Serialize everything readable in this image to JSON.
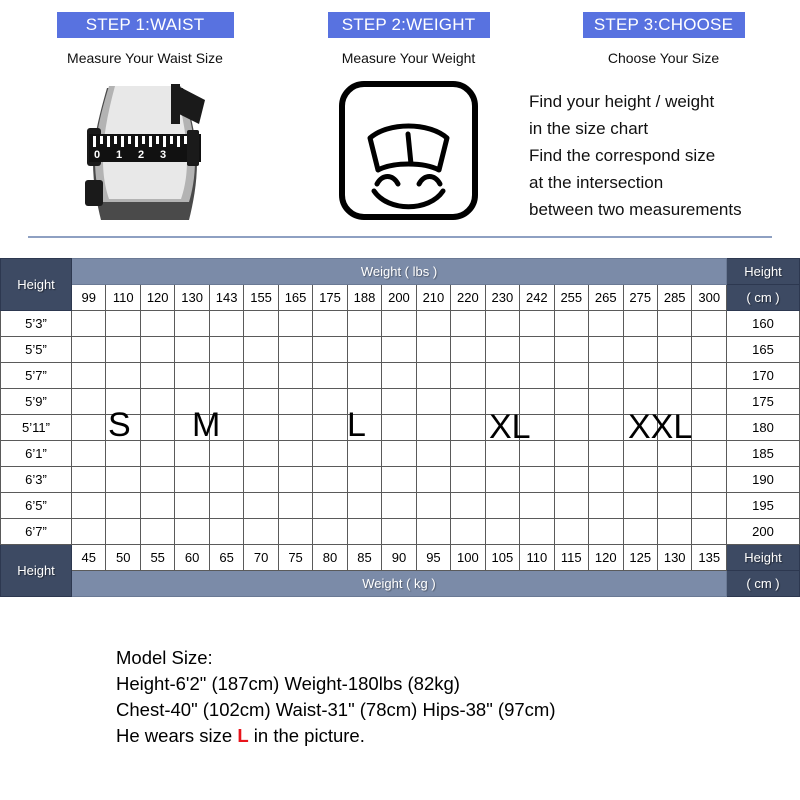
{
  "steps": [
    {
      "badge": "STEP 1:WAIST",
      "subtitle": "Measure Your Waist Size",
      "icon": "waist-tape-measure-illustration"
    },
    {
      "badge": "STEP 2:WEIGHT",
      "subtitle": "Measure Your Weight",
      "icon": "smiling-weight-scale-illustration"
    },
    {
      "badge": "STEP 3:CHOOSE",
      "subtitle": "Choose Your Size",
      "icon": "none"
    }
  ],
  "instructions": [
    "Find your height  / weight",
    "in the size chart",
    "Find the correspond size",
    "at the intersection",
    "between  two measurements"
  ],
  "table": {
    "height_label": "Height",
    "height_cm_label": "Height",
    "height_cm_unit": "( cm )",
    "weight_lbs_label": "Weight ( lbs )",
    "weight_kg_label": "Weight ( kg )",
    "lbs": [
      99,
      110,
      120,
      130,
      143,
      155,
      165,
      175,
      188,
      200,
      210,
      220,
      230,
      242,
      255,
      265,
      275,
      285,
      300
    ],
    "kg": [
      45,
      50,
      55,
      60,
      65,
      70,
      75,
      80,
      85,
      90,
      95,
      100,
      105,
      110,
      115,
      120,
      125,
      130,
      135
    ],
    "heights_ft": [
      "5’3”",
      "5’5”",
      "5’7”",
      "5’9”",
      "5’11”",
      "6’1”",
      "6’3”",
      "6’5”",
      "6’7”"
    ],
    "heights_cm": [
      160,
      165,
      170,
      175,
      180,
      185,
      190,
      195,
      200
    ],
    "size_labels": [
      "S",
      "M",
      "L",
      "XL",
      "XXL"
    ],
    "colors": {
      "white": "#ffffff",
      "light_pink": "#f9e4f7",
      "pink": "#f9b8dd",
      "magenta": "#e367d3",
      "salmon": "#e2b9b2",
      "purple": "#9a6ed2",
      "header_dark": "#3d4a63",
      "header_light": "#7b8ba8",
      "step_badge": "#5872e0"
    },
    "grid": [
      [
        "w",
        "lp",
        "p",
        "p",
        "m",
        "m",
        "m",
        "m",
        "s",
        "s",
        "s",
        "s",
        "s",
        "u",
        "u",
        "u",
        "w",
        "w",
        "w"
      ],
      [
        "w",
        "lp",
        "p",
        "p",
        "m",
        "m",
        "m",
        "m",
        "m",
        "s",
        "s",
        "s",
        "s",
        "s",
        "u",
        "u",
        "u",
        "u",
        "u"
      ],
      [
        "w",
        "lp",
        "lp",
        "p",
        "p",
        "m",
        "m",
        "m",
        "m",
        "m",
        "s",
        "s",
        "s",
        "s",
        "u",
        "u",
        "u",
        "u",
        "u"
      ],
      [
        "w",
        "lp",
        "lp",
        "p",
        "p",
        "m",
        "m",
        "m",
        "m",
        "m",
        "s",
        "s",
        "s",
        "s",
        "u",
        "u",
        "u",
        "u",
        "u"
      ],
      [
        "w",
        "lp",
        "lp",
        "p",
        "p",
        "p",
        "m",
        "m",
        "m",
        "m",
        "m",
        "s",
        "s",
        "s",
        "s",
        "u",
        "u",
        "u",
        "u"
      ],
      [
        "w",
        "w",
        "lp",
        "lp",
        "p",
        "p",
        "p",
        "m",
        "m",
        "m",
        "m",
        "m",
        "s",
        "s",
        "s",
        "s",
        "u",
        "u",
        "u"
      ],
      [
        "w",
        "w",
        "lp",
        "lp",
        "p",
        "p",
        "p",
        "p",
        "m",
        "m",
        "m",
        "m",
        "s",
        "s",
        "s",
        "s",
        "u",
        "u",
        "u"
      ],
      [
        "w",
        "w",
        "lp",
        "lp",
        "p",
        "p",
        "p",
        "p",
        "m",
        "m",
        "m",
        "m",
        "s",
        "s",
        "s",
        "s",
        "u",
        "u",
        "u"
      ],
      [
        "w",
        "w",
        "w",
        "w",
        "w",
        "p",
        "p",
        "p",
        "m",
        "m",
        "m",
        "m",
        "s",
        "s",
        "s",
        "s",
        "u",
        "u",
        "u"
      ]
    ]
  },
  "footer": {
    "line1": "Model Size:",
    "line2": "Height-6'2\" (187cm) Weight-180lbs (82kg)",
    "line3": "Chest-40\" (102cm) Waist-31\" (78cm) Hips-38\" (97cm)",
    "line4_prefix": "He wears size ",
    "line4_size": "L",
    "line4_suffix": " in the picture."
  }
}
